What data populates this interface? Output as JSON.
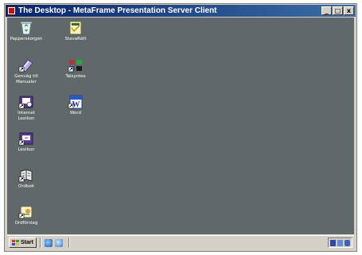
{
  "window": {
    "title": "The Desktop - MetaFrame Presentation Server Client",
    "buttons": {
      "minimize": "_",
      "maximize": "□",
      "close": "x"
    }
  },
  "desktop": {
    "background": "#61686a",
    "icons": [
      {
        "label": "Papperskorgen",
        "icon": "recycle-bin-icon"
      },
      {
        "label": "StavaRätt",
        "icon": "spell-check-icon"
      },
      {
        "label": "Genväg till Manualer",
        "icon": "manuals-shortcut-icon"
      },
      {
        "label": "Talsyntes",
        "icon": "speech-synthesis-icon"
      },
      {
        "label": "Internet Lexikon",
        "icon": "internet-lexicon-icon"
      },
      {
        "label": "Word",
        "icon": "word-icon"
      },
      {
        "label": "Lexikon",
        "icon": "lexicon-icon"
      },
      {
        "label": "Ordbok",
        "icon": "dictionary-icon"
      },
      {
        "label": "Ordförslag",
        "icon": "word-suggestion-icon"
      }
    ]
  },
  "taskbar": {
    "start_label": "Start",
    "quick_launch": [
      "internet-explorer-icon",
      "outlook-express-icon"
    ],
    "tray_icons": [
      "network-icon",
      "volume-icon",
      "security-icon"
    ]
  },
  "colors": {
    "titlebar_start": "#0a246a",
    "titlebar_end": "#3a6ea5",
    "chrome": "#d4d0c8"
  }
}
